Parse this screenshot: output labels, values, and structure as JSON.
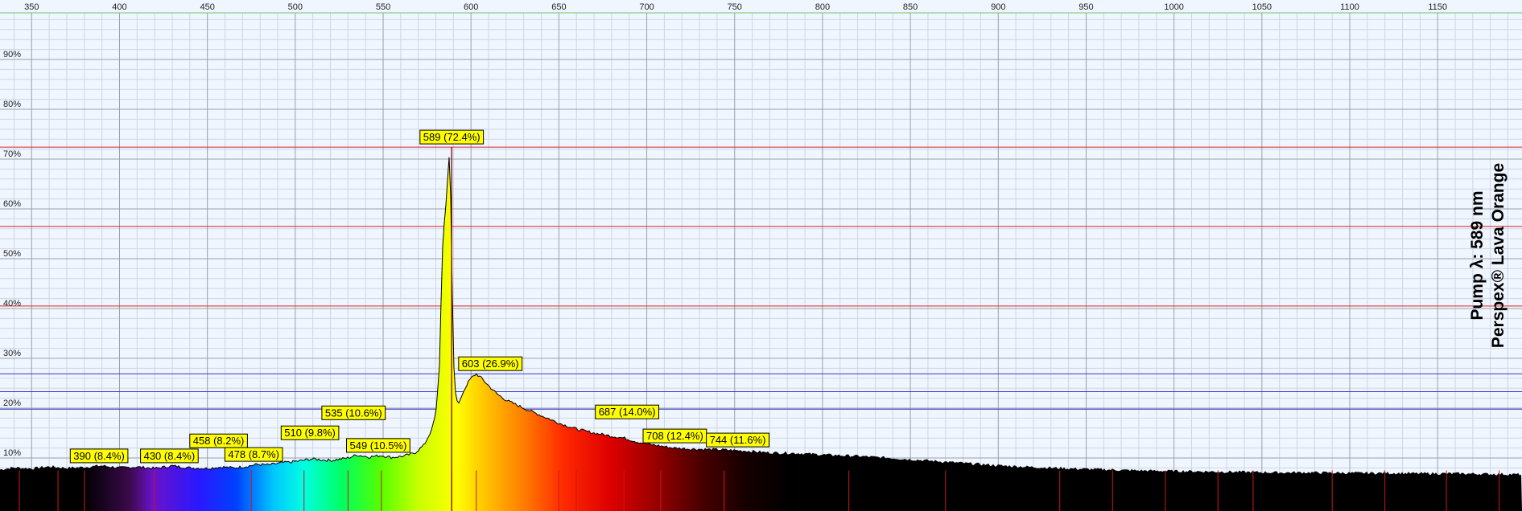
{
  "chart_data": {
    "type": "area",
    "title": "",
    "xlabel": "",
    "ylabel": "",
    "xlim": [
      332,
      1198
    ],
    "ylim": [
      0,
      100
    ],
    "x_ticks": [
      350,
      400,
      450,
      500,
      550,
      600,
      650,
      700,
      750,
      800,
      850,
      900,
      950,
      1000,
      1050,
      1100,
      1150
    ],
    "y_ticks": [
      10,
      20,
      30,
      40,
      50,
      60,
      70,
      80,
      90
    ],
    "y_tick_suffix": "%",
    "grid": true,
    "side_text": [
      "Pump λ: 589 nm",
      "Perspex® Lava Orange"
    ],
    "series": [
      {
        "x": [
          332,
          340,
          350,
          360,
          370,
          380,
          390,
          400,
          410,
          420,
          430,
          440,
          450,
          458,
          465,
          472,
          478,
          485,
          492,
          500,
          510,
          520,
          530,
          535,
          542,
          549,
          555,
          562,
          568,
          573,
          577,
          580,
          582,
          583,
          584,
          585,
          586,
          587,
          588,
          589,
          590,
          591,
          592,
          593,
          594,
          596,
          598,
          600,
          603,
          606,
          610,
          615,
          620,
          625,
          630,
          640,
          650,
          660,
          670,
          680,
          687,
          695,
          700,
          708,
          715,
          725,
          735,
          744,
          755,
          770,
          785,
          800,
          820,
          840,
          860,
          880,
          900,
          920,
          940,
          960,
          980,
          1000,
          1020,
          1040,
          1060,
          1080,
          1100,
          1120,
          1140,
          1160,
          1180,
          1198
        ],
        "values": [
          7.6,
          8.0,
          7.8,
          8.2,
          7.9,
          8.1,
          8.4,
          8.0,
          8.2,
          7.9,
          8.4,
          8.0,
          7.9,
          8.2,
          8.0,
          8.3,
          8.7,
          8.6,
          9.0,
          9.3,
          9.8,
          9.5,
          10.0,
          10.6,
          10.2,
          10.5,
          10.1,
          10.4,
          11.0,
          12.5,
          15.0,
          19.0,
          28.0,
          42.0,
          54.0,
          58.0,
          62.0,
          68.0,
          72.4,
          50.0,
          30.0,
          23.5,
          21.5,
          21.0,
          21.8,
          23.5,
          25.0,
          26.0,
          26.9,
          26.0,
          24.5,
          22.8,
          21.6,
          20.8,
          20.0,
          18.5,
          17.0,
          15.8,
          15.0,
          14.4,
          14.0,
          13.2,
          12.8,
          12.4,
          12.0,
          11.8,
          11.7,
          11.6,
          11.4,
          11.0,
          10.9,
          10.6,
          10.3,
          9.9,
          9.4,
          8.9,
          8.4,
          8.1,
          7.8,
          7.6,
          7.4,
          7.3,
          7.2,
          7.1,
          7.0,
          7.0,
          6.9,
          6.9,
          6.8,
          6.8,
          6.7,
          6.6
        ]
      }
    ],
    "peak_labels": [
      {
        "x": 390,
        "value": 8.4,
        "text": "390 (8.4%)"
      },
      {
        "x": 430,
        "value": 8.4,
        "text": "430 (8.4%)"
      },
      {
        "x": 458,
        "value": 8.2,
        "text": "458 (8.2%)"
      },
      {
        "x": 478,
        "value": 8.7,
        "text": "478 (8.7%)"
      },
      {
        "x": 510,
        "value": 9.8,
        "text": "510 (9.8%)"
      },
      {
        "x": 535,
        "value": 10.6,
        "text": "535 (10.6%)"
      },
      {
        "x": 549,
        "value": 10.5,
        "text": "549 (10.5%)"
      },
      {
        "x": 589,
        "value": 72.4,
        "text": "589 (72.4%)"
      },
      {
        "x": 603,
        "value": 26.9,
        "text": "603 (26.9%)"
      },
      {
        "x": 687,
        "value": 14.0,
        "text": "687 (14.0%)"
      },
      {
        "x": 708,
        "value": 12.4,
        "text": "708 (12.4%)"
      },
      {
        "x": 744,
        "value": 11.6,
        "text": "744 (11.6%)"
      }
    ],
    "reference_lines": [
      {
        "value": 72.4,
        "color": "#e02020"
      },
      {
        "value": 56.5,
        "color": "#e02020"
      },
      {
        "value": 40.5,
        "color": "#e02020"
      },
      {
        "value": 26.9,
        "color": "#3333cc"
      },
      {
        "value": 23.3,
        "color": "#3333cc"
      },
      {
        "value": 19.8,
        "color": "#3333cc"
      }
    ],
    "marker_lines_x": [
      343,
      365,
      380,
      420,
      475,
      505,
      530,
      549,
      589,
      603,
      650,
      660,
      687,
      708,
      744,
      815,
      870,
      935,
      965,
      995,
      1025,
      1045,
      1090,
      1120,
      1155,
      1185
    ],
    "colors": {
      "background": "#f0f6ff",
      "grid_major": "#9aa0a6",
      "grid_minor": "#cdd6e2",
      "label_fill": "#ffff00",
      "marker_line": "#d01818",
      "top_line": "#66cc66"
    }
  }
}
